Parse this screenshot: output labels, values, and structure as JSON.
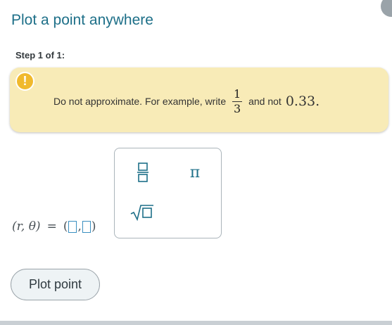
{
  "header": {
    "title": "Plot a point anywhere"
  },
  "step": {
    "label": "Step 1 of 1:"
  },
  "note": {
    "icon": "exclamation-icon",
    "icon_glyph": "!",
    "text_before": "Do not approximate. For example, write",
    "frac_num": "1",
    "frac_den": "3",
    "text_between": "and not",
    "decimal": "0.33",
    "period": "."
  },
  "palette": {
    "fraction_icon": "fraction-template-icon",
    "pi_symbol": "π",
    "sqrt_icon": "square-root-icon"
  },
  "expression": {
    "lhs": "(r, θ)",
    "equals": "=",
    "open": "(",
    "comma": ",",
    "close": ")"
  },
  "actions": {
    "plot_label": "Plot point"
  },
  "colors": {
    "title": "#1d6f88",
    "note_bg": "#f8ebb7",
    "warning": "#f0b92d",
    "accent": "#1d6f88",
    "slot_border": "#3a8fc0"
  }
}
